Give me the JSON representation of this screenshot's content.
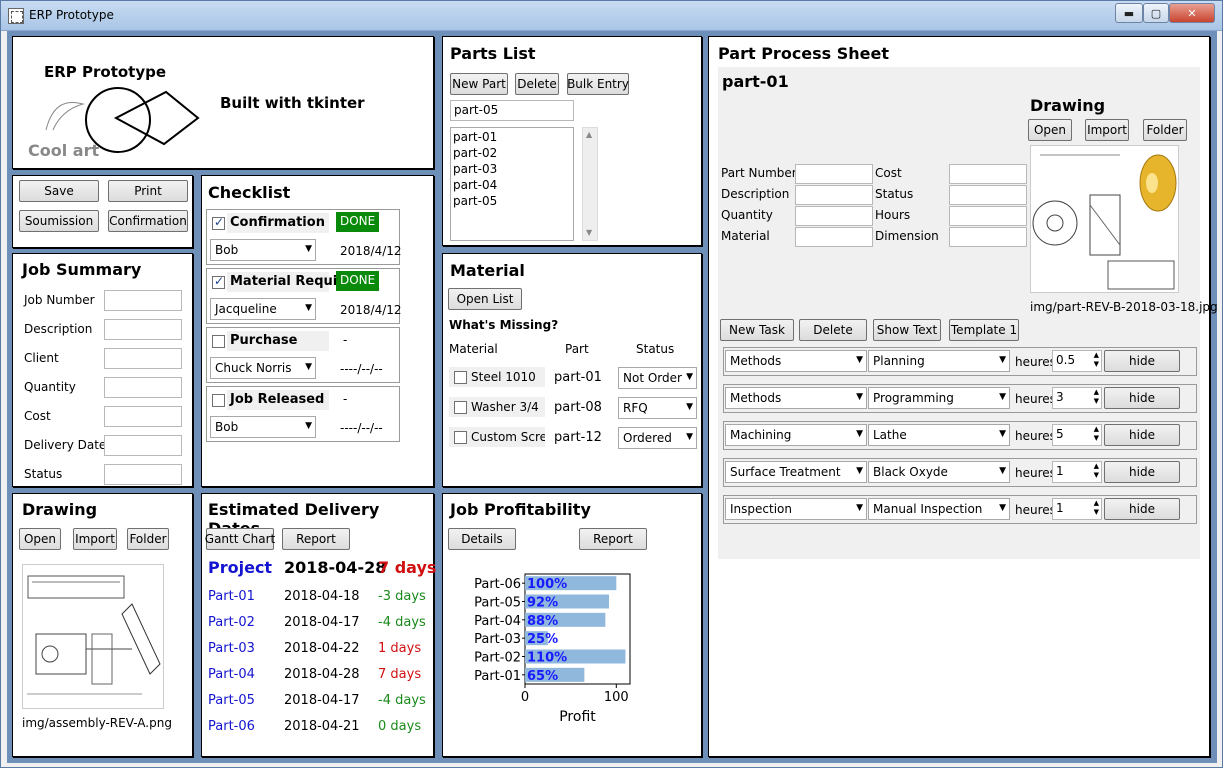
{
  "window": {
    "title": "ERP Prototype",
    "min": "▬",
    "max": "▢",
    "close": "✕"
  },
  "header": {
    "title": "ERP Prototype",
    "subtitle": "Built with tkinter",
    "art_caption": "Cool art"
  },
  "actions": {
    "save": "Save",
    "print": "Print",
    "submission": "Soumission",
    "confirmation": "Confirmation"
  },
  "checklist": {
    "title": "Checklist",
    "items": [
      {
        "label": "Confirmation",
        "checked": true,
        "status": "DONE",
        "person": "Bob",
        "date": "2018/4/12"
      },
      {
        "label": "Material Requis",
        "checked": true,
        "status": "DONE",
        "person": "Jacqueline",
        "date": "2018/4/12"
      },
      {
        "label": "Purchase",
        "checked": false,
        "status": "-",
        "person": "Chuck Norris",
        "date": "----/--/--"
      },
      {
        "label": "Job Released",
        "checked": false,
        "status": "-",
        "person": "Bob",
        "date": "----/--/--"
      }
    ]
  },
  "job_summary": {
    "title": "Job Summary",
    "fields": [
      "Job Number",
      "Description",
      "Client",
      "Quantity",
      "Cost",
      "Delivery Date",
      "Status"
    ]
  },
  "drawing_left": {
    "title": "Drawing",
    "open": "Open",
    "import": "Import",
    "folder": "Folder",
    "filename": "img/assembly-REV-A.png"
  },
  "delivery": {
    "title": "Estimated Delivery Dates",
    "gantt": "Gantt Chart",
    "report": "Report",
    "project": {
      "name": "Project",
      "date": "2018-04-28",
      "days": "7 days"
    },
    "rows": [
      {
        "part": "Part-01",
        "date": "2018-04-18",
        "days": "-3 days",
        "color": "#1a8a1a"
      },
      {
        "part": "Part-02",
        "date": "2018-04-17",
        "days": "-4 days",
        "color": "#1a8a1a"
      },
      {
        "part": "Part-03",
        "date": "2018-04-22",
        "days": "1 days",
        "color": "#d01010"
      },
      {
        "part": "Part-04",
        "date": "2018-04-28",
        "days": "7 days",
        "color": "#d01010"
      },
      {
        "part": "Part-05",
        "date": "2018-04-17",
        "days": "-4 days",
        "color": "#1a8a1a"
      },
      {
        "part": "Part-06",
        "date": "2018-04-21",
        "days": "0 days",
        "color": "#1a8a1a"
      }
    ]
  },
  "parts_list": {
    "title": "Parts List",
    "new_part": "New Part",
    "delete": "Delete",
    "bulk": "Bulk Entry",
    "entry_value": "part-05",
    "items": [
      "part-01",
      "part-02",
      "part-03",
      "part-04",
      "part-05"
    ]
  },
  "material": {
    "title": "Material",
    "open_list": "Open List",
    "missing": "What's Missing?",
    "headers": [
      "Material",
      "Part",
      "Status"
    ],
    "rows": [
      {
        "name": "Steel 1010",
        "part": "part-01",
        "status": "Not Order"
      },
      {
        "name": "Washer 3/4",
        "part": "part-08",
        "status": "RFQ"
      },
      {
        "name": "Custom Screv",
        "part": "part-12",
        "status": "Ordered"
      }
    ]
  },
  "profit": {
    "title": "Job Profitability",
    "details": "Details",
    "report": "Report"
  },
  "chart_data": {
    "type": "bar",
    "orientation": "horizontal",
    "categories": [
      "Part-06",
      "Part-05",
      "Part-04",
      "Part-03",
      "Part-02",
      "Part-01"
    ],
    "values": [
      100,
      92,
      88,
      25,
      110,
      65
    ],
    "value_labels": [
      "100%",
      "92%",
      "88%",
      "25%",
      "110%",
      "65%"
    ],
    "xlabel": "Profit",
    "xticks": [
      "0",
      "100"
    ],
    "xlim": [
      0,
      115
    ],
    "bar_color": "#8fb8dc",
    "label_color": "#1a1aff"
  },
  "process": {
    "title": "Part Process Sheet",
    "part": "part-01",
    "drawing_title": "Drawing",
    "open": "Open",
    "import": "Import",
    "folder": "Folder",
    "filename": "img/part-REV-B-2018-03-18.jpg",
    "fields_left": [
      "Part Number",
      "Description",
      "Quantity",
      "Material"
    ],
    "fields_right": [
      "Cost",
      "Status",
      "Hours",
      "Dimension"
    ],
    "new_task": "New Task",
    "delete": "Delete",
    "show_text": "Show Text",
    "template": "Template 1",
    "hours_label": "heures",
    "hide": "hide",
    "tasks": [
      {
        "dept": "Methods",
        "op": "Planning",
        "hours": "0.5"
      },
      {
        "dept": "Methods",
        "op": "Programming",
        "hours": "3"
      },
      {
        "dept": "Machining",
        "op": "Lathe",
        "hours": "5"
      },
      {
        "dept": "Surface Treatment",
        "op": "Black Oxyde",
        "hours": "1"
      },
      {
        "dept": "Inspection",
        "op": "Manual Inspection",
        "hours": "1"
      }
    ]
  }
}
